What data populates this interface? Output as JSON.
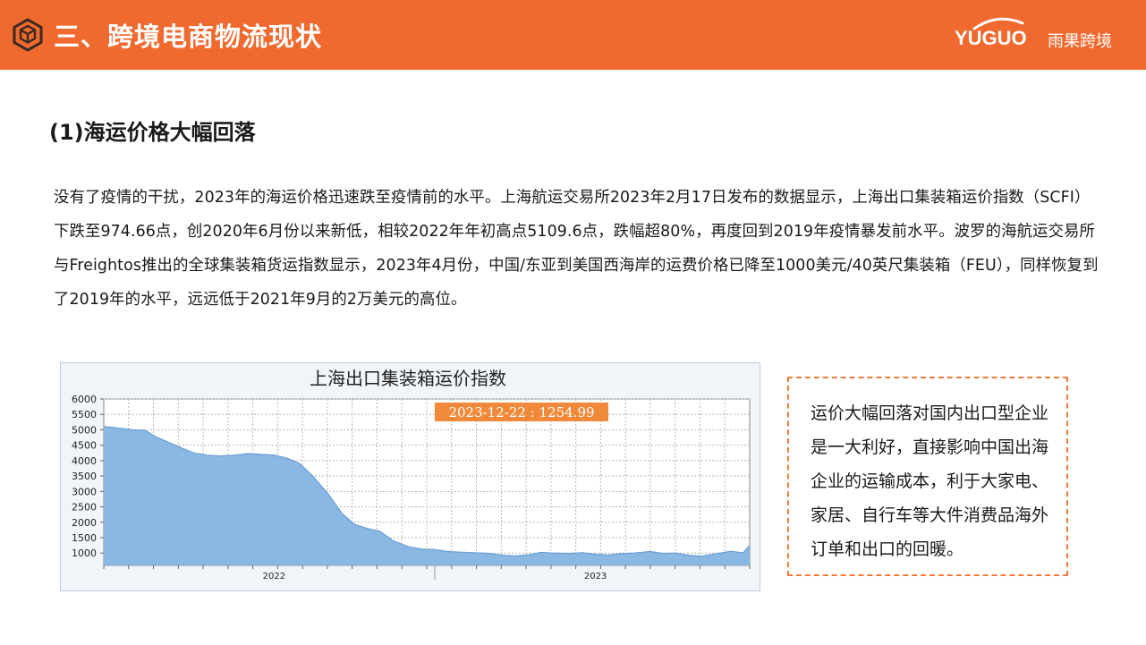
{
  "header": {
    "title": "三、跨境电商物流现状",
    "brand_name": "YUGUO",
    "brand_cn": "雨果跨境",
    "accent_color": "#f06a2f",
    "icon": "cube-hexagon-icon"
  },
  "section": {
    "title": "(1)海运价格大幅回落"
  },
  "paragraph": {
    "text": "没有了疫情的干扰，2023年的海运价格迅速跌至疫情前的水平。上海航运交易所2023年2月17日发布的数据显示，上海出口集装箱运价指数（SCFI）下跌至974.66点，创2020年6月份以来新低，相较2022年年初高点5109.6点，跌幅超80%，再度回到2019年疫情暴发前水平。波罗的海航运交易所与Freightos推出的全球集装箱货运指数显示，2023年4月份，中国/东亚到美国西海岸的运费价格已降至1000美元/40英尺集装箱（FEU），同样恢复到了2019年的水平，远远低于2021年9月的2万美元的高位。"
  },
  "note": {
    "text": "运价大幅回落对国内出口型企业是一大利好，直接影响中国出海企业的运输成本，利于大家电、家居、自行车等大件消费品海外订单和出口的回暖。",
    "border_color": "#f07a3f"
  },
  "chart_data": {
    "type": "area",
    "title": "上海出口集装箱运价指数",
    "tooltip": "2023-12-22 : 1254.99",
    "fill_color": "#8ab8e3",
    "line_color": "#6a9fd4",
    "tooltip_color": "#f08a3a",
    "ylim": [
      600,
      6000
    ],
    "yticks": [
      1000,
      1500,
      2000,
      2500,
      3000,
      3500,
      4000,
      4500,
      5000,
      5500,
      6000
    ],
    "xlim": [
      2021.97,
      2023.98
    ],
    "xticks": [
      {
        "x": 2022.0,
        "label": "2022"
      },
      {
        "x": 2023.0,
        "label": "2023"
      }
    ],
    "x": [
      2021.97,
      2022.02,
      2022.06,
      2022.1,
      2022.13,
      2022.17,
      2022.21,
      2022.25,
      2022.29,
      2022.33,
      2022.38,
      2022.42,
      2022.46,
      2022.5,
      2022.54,
      2022.58,
      2022.62,
      2022.67,
      2022.71,
      2022.75,
      2022.79,
      2022.83,
      2022.87,
      2022.92,
      2022.96,
      2023.0,
      2023.04,
      2023.08,
      2023.12,
      2023.17,
      2023.21,
      2023.25,
      2023.29,
      2023.33,
      2023.37,
      2023.42,
      2023.46,
      2023.5,
      2023.54,
      2023.58,
      2023.62,
      2023.67,
      2023.71,
      2023.75,
      2023.79,
      2023.83,
      2023.87,
      2023.92,
      2023.96,
      2023.98
    ],
    "values": [
      5110,
      5050,
      5000,
      4980,
      4780,
      4600,
      4420,
      4250,
      4180,
      4150,
      4180,
      4230,
      4200,
      4180,
      4080,
      3900,
      3500,
      2900,
      2300,
      1930,
      1800,
      1700,
      1400,
      1200,
      1130,
      1110,
      1050,
      1030,
      1010,
      990,
      930,
      910,
      940,
      1020,
      1000,
      990,
      1010,
      960,
      940,
      980,
      1000,
      1050,
      990,
      1000,
      930,
      900,
      970,
      1060,
      1010,
      1255
    ]
  }
}
